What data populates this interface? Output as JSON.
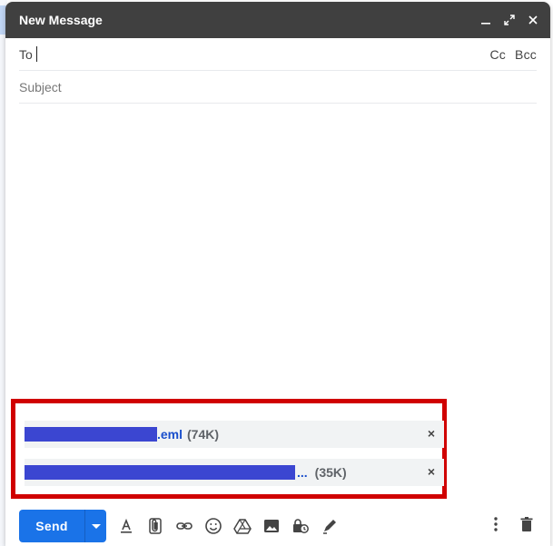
{
  "window": {
    "title": "New Message",
    "controls": [
      "minimize-icon",
      "expand-icon",
      "close-icon"
    ]
  },
  "to_field": {
    "label": "To",
    "value": ""
  },
  "cc_label": "Cc",
  "bcc_label": "Bcc",
  "subject": {
    "placeholder": "Subject",
    "value": ""
  },
  "attachments": [
    {
      "name_visible": ".eml",
      "size": "(74K)",
      "name_redacted": true
    },
    {
      "name_visible": "...",
      "size": "(35K)",
      "name_redacted": true
    }
  ],
  "toolbar": {
    "send_label": "Send",
    "icons": [
      "text-format-icon",
      "attach-icon",
      "link-icon",
      "emoji-icon",
      "drive-icon",
      "image-icon",
      "confidential-icon",
      "signature-icon"
    ],
    "right_icons": [
      "more-options-icon",
      "discard-icon"
    ]
  },
  "colors": {
    "titlebar": "#404040",
    "send_button": "#1a73e8",
    "highlight_box": "#d00000",
    "redaction": "#3b46d1"
  }
}
